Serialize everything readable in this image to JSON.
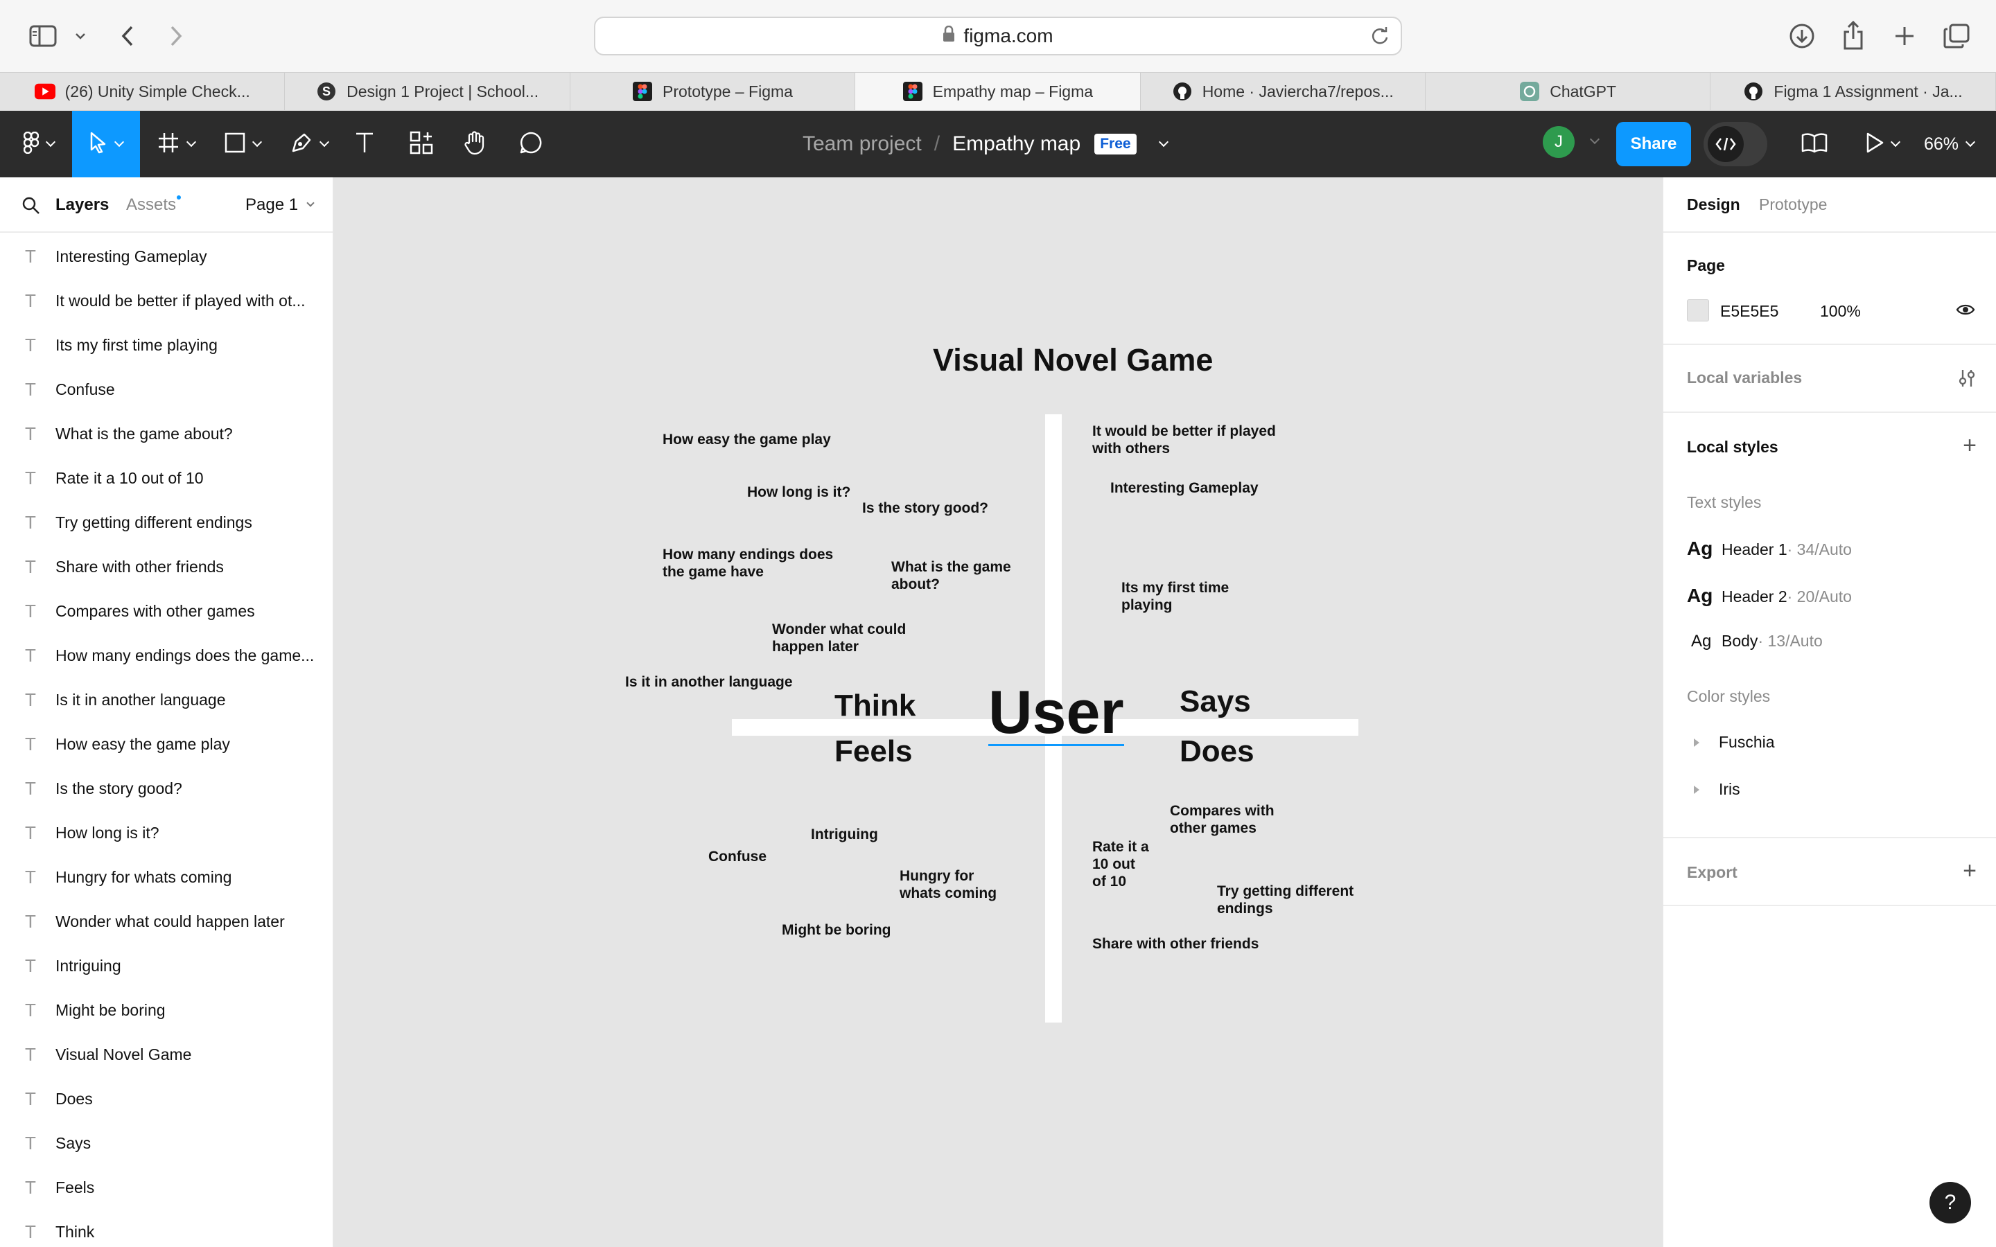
{
  "browser": {
    "url": "figma.com",
    "tabs": [
      {
        "label": "(26) Unity Simple Check...",
        "icon": "youtube-icon",
        "active": false
      },
      {
        "label": "Design 1 Project | School...",
        "icon": "schoology-icon",
        "active": false
      },
      {
        "label": "Prototype – Figma",
        "icon": "figma-icon",
        "active": false
      },
      {
        "label": "Empathy map – Figma",
        "icon": "figma-icon",
        "active": true
      },
      {
        "label": "Home · Javiercha7/repos...",
        "icon": "github-icon",
        "active": false
      },
      {
        "label": "ChatGPT",
        "icon": "chatgpt-icon",
        "active": false
      },
      {
        "label": "Figma 1 Assignment · Ja...",
        "icon": "github-icon",
        "active": false
      }
    ]
  },
  "figma": {
    "breadcrumb": {
      "team": "Team project",
      "separator": "/",
      "file": "Empathy map"
    },
    "badge": "Free",
    "avatar_initial": "J",
    "share_label": "Share",
    "zoom": "66%"
  },
  "left_panel": {
    "tabs": {
      "layers": "Layers",
      "assets": "Assets"
    },
    "page": "Page 1",
    "layers": [
      "Interesting Gameplay",
      "It would be better if played with ot...",
      "Its my first time playing",
      "Confuse",
      "What is the game about?",
      "Rate it a 10 out of 10",
      "Try getting different endings",
      "Share with other friends",
      "Compares with other games",
      "How many endings does the game...",
      "Is it in another language",
      "How easy the game play",
      "Is the story good?",
      "How long is it?",
      "Hungry for whats coming",
      "Wonder what could happen later",
      "Intriguing",
      "Might be boring",
      "Visual Novel Game",
      "Does",
      "Says",
      "Feels",
      "Think"
    ]
  },
  "right_panel": {
    "tabs": {
      "design": "Design",
      "prototype": "Prototype"
    },
    "page": {
      "title": "Page",
      "color": "E5E5E5",
      "opacity": "100%"
    },
    "local_variables": "Local variables",
    "local_styles": "Local styles",
    "text_styles_title": "Text styles",
    "text_styles": [
      {
        "ag": "Ag",
        "name": "Header 1",
        "meta": " · 34/Auto"
      },
      {
        "ag": "Ag",
        "name": "Header 2",
        "meta": " · 20/Auto"
      },
      {
        "ag": "Ag",
        "name": "Body",
        "meta": " · 13/Auto"
      }
    ],
    "color_styles_title": "Color styles",
    "color_styles": [
      "Fuschia",
      "Iris"
    ],
    "export": "Export"
  },
  "canvas": {
    "title": "Visual Novel Game",
    "center": "User",
    "quadrants": {
      "think": "Think",
      "says": "Says",
      "feels": "Feels",
      "does": "Does"
    },
    "think_notes": [
      "How easy the game play",
      "How long is it?",
      "Is the story good?",
      "How many endings does\nthe game have",
      "What is the game\nabout?",
      "Wonder what could\nhappen later",
      "Is it in another language"
    ],
    "says_notes": [
      "It would be better if played\nwith others",
      "Interesting Gameplay",
      "Its my first time\nplaying"
    ],
    "feels_notes": [
      "Intriguing",
      "Confuse",
      "Hungry for\nwhats coming",
      "Might be boring"
    ],
    "does_notes": [
      "Compares with\nother games",
      "Rate it a\n10 out\nof 10",
      "Try getting different\nendings",
      "Share with other friends"
    ],
    "background_color": "#E5E5E5"
  },
  "help_label": "?"
}
